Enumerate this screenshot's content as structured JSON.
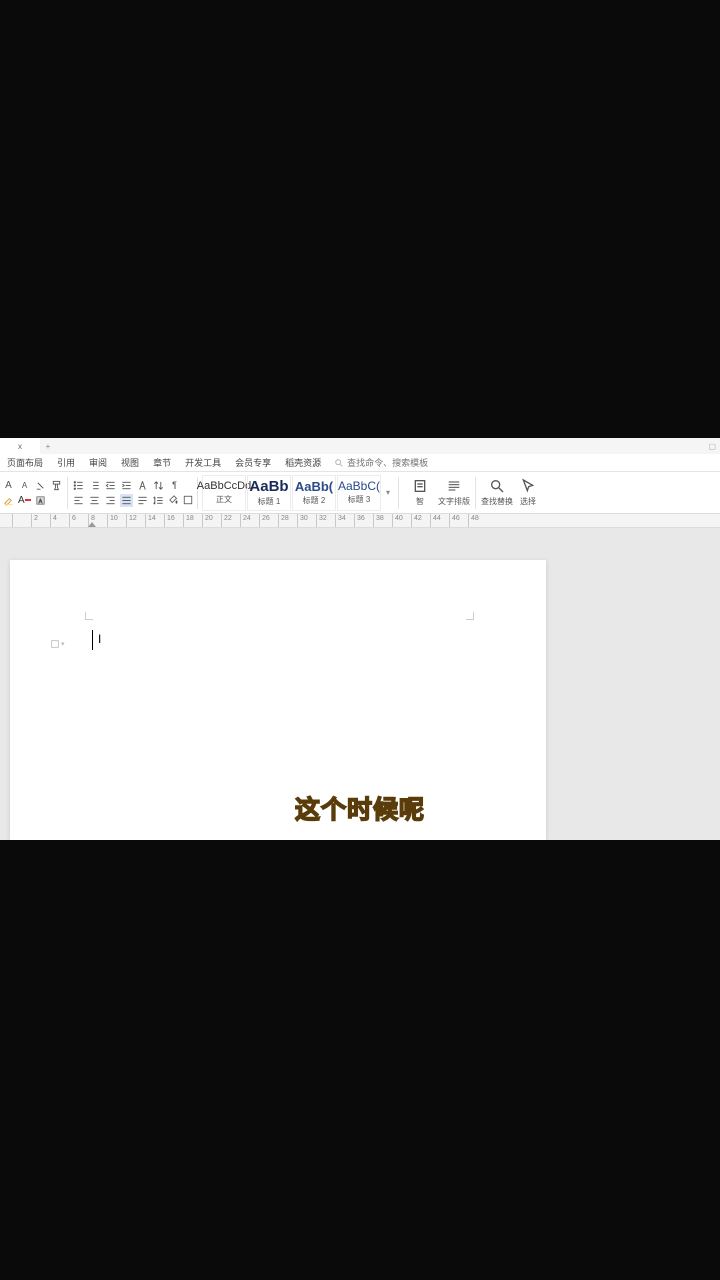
{
  "tabbar": {
    "tab_label": "x",
    "add": "+"
  },
  "menubar": {
    "items": [
      "页面布局",
      "引用",
      "审阅",
      "视图",
      "章节",
      "开发工具",
      "会员专享",
      "稻壳资源"
    ],
    "search_placeholder": "查找命令、搜索模板"
  },
  "ribbon": {
    "styles": [
      {
        "preview": "AaBbCcDd",
        "name": "正文",
        "cls": ""
      },
      {
        "preview": "AaBb",
        "name": "标题 1",
        "cls": "big"
      },
      {
        "preview": "AaBb(",
        "name": "标题 2",
        "cls": "med"
      },
      {
        "preview": "AaBbC(",
        "name": "标题 3",
        "cls": "sm"
      }
    ],
    "text_tools": "文字排版",
    "smart_format_lbl": "智",
    "find_replace": "查找替换",
    "select": "选择"
  },
  "ruler": {
    "marks": [
      "",
      "2",
      "4",
      "6",
      "8",
      "10",
      "12",
      "14",
      "16",
      "18",
      "20",
      "22",
      "24",
      "26",
      "28",
      "30",
      "32",
      "34",
      "36",
      "38",
      "40",
      "42",
      "44",
      "46",
      "48"
    ]
  },
  "subtitle": "这个时候呢"
}
